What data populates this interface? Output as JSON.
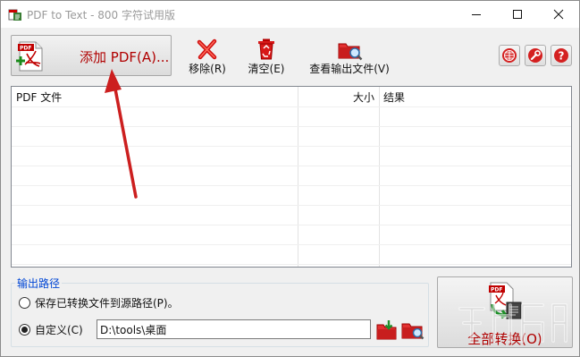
{
  "window": {
    "title": "PDF to Text - 800 字符试用版"
  },
  "toolbar": {
    "add_pdf_label": "添加 PDF(A)...",
    "remove_label": "移除(R)",
    "clear_label": "清空(E)",
    "view_output_label": "查看输出文件(V)"
  },
  "file_list": {
    "columns": [
      "PDF 文件",
      "大小",
      "结果"
    ],
    "rows": []
  },
  "output": {
    "group_title": "输出路径",
    "option_source_label": "保存已转换文件到源路径(P)。",
    "option_custom_label": "自定义(C)",
    "selected_option": "custom",
    "path_value": "D:\\tools\\桌面"
  },
  "convert": {
    "label": "全部转换(O)"
  },
  "icons": {
    "app": "app-icon",
    "add_pdf": "pdf-add-icon",
    "remove": "red-x-icon",
    "clear": "recycle-bin-icon",
    "view_output": "folder-search-icon",
    "web": "globe-icon",
    "settings": "wrench-icon",
    "help": "question-icon",
    "browse_folder": "folder-arrow-icon",
    "open_folder": "folder-search-icon",
    "convert_all": "pdf-convert-icon"
  },
  "colors": {
    "accent_red": "#b00000",
    "group_title_blue": "#0046d5",
    "annotation_arrow": "#cc1f1f"
  }
}
